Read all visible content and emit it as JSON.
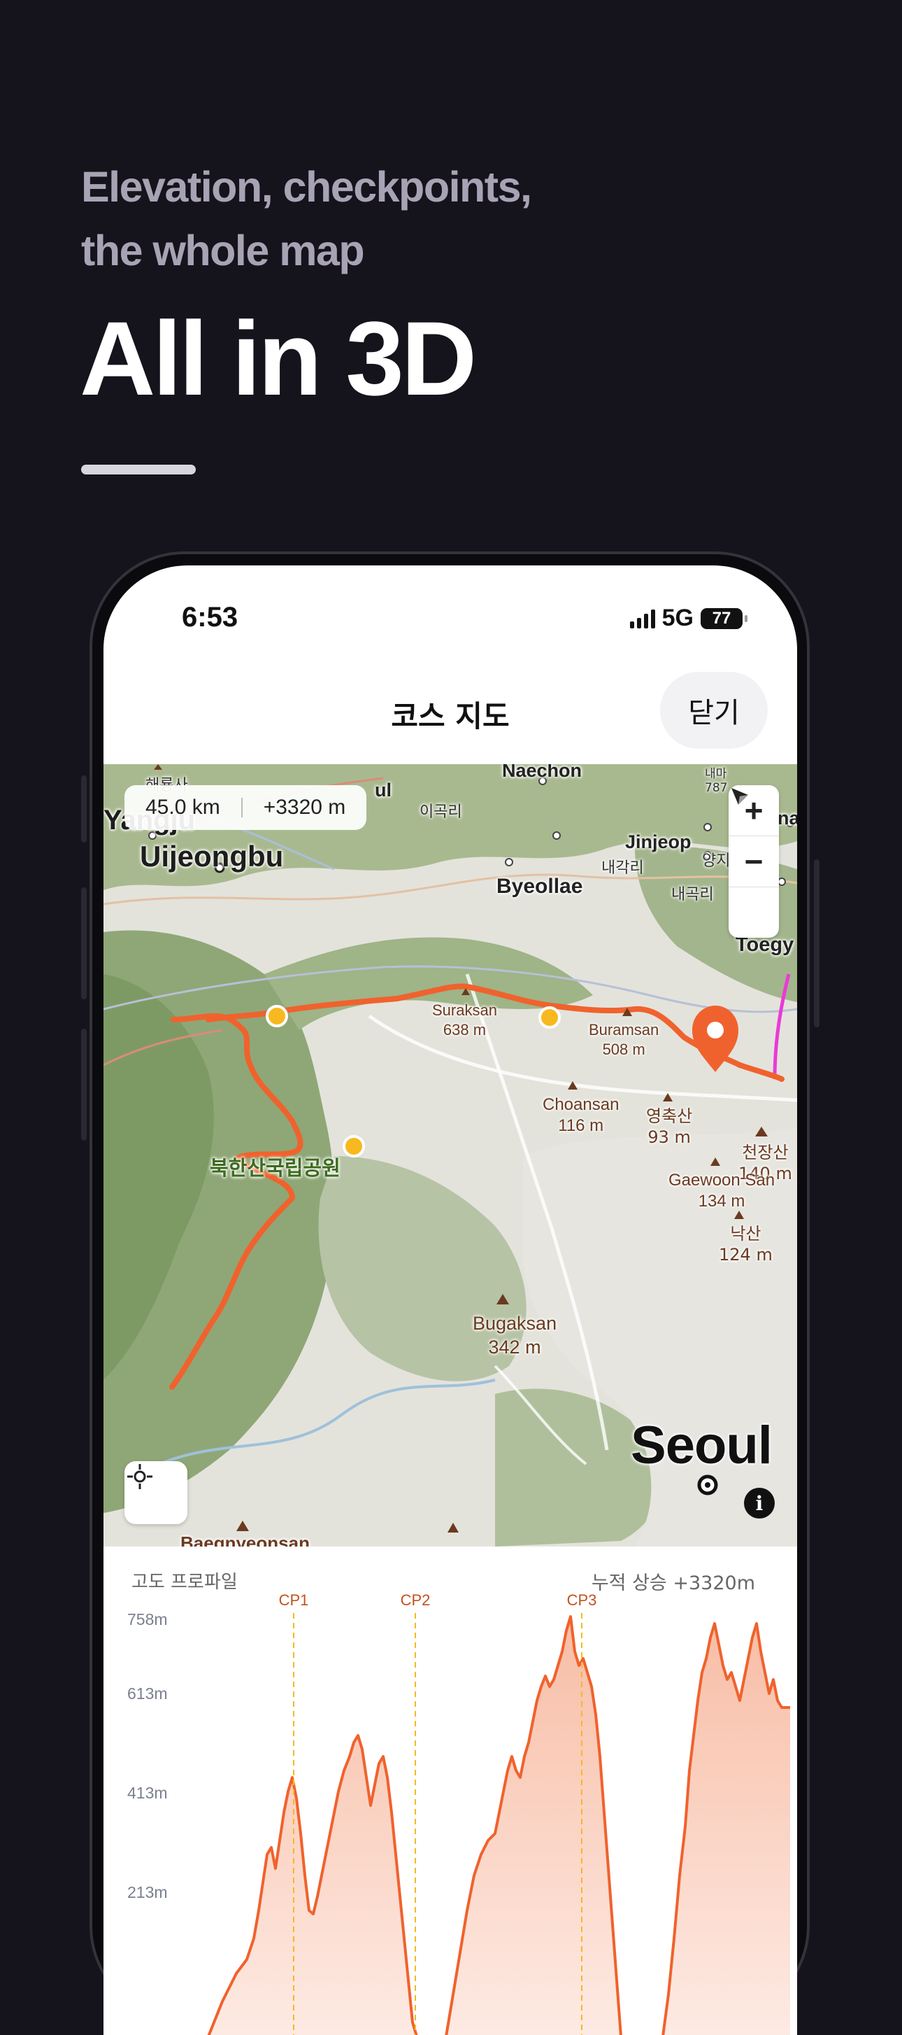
{
  "headline": {
    "subtitle_line1": "Elevation, checkpoints,",
    "subtitle_line2": "the whole map",
    "title": "All in 3D"
  },
  "status_bar": {
    "time": "6:53",
    "network": "5G",
    "battery": "77"
  },
  "nav": {
    "title": "코스 지도",
    "close_label": "닫기"
  },
  "map": {
    "distance": "45.0 km",
    "ascent": "+3320 m",
    "zoom_in_icon": "plus-icon",
    "zoom_out_icon": "minus-icon",
    "compass_icon": "navigation-arrow-icon",
    "locate_icon": "crosshair-icon",
    "info_icon": "info-icon",
    "route_color": "#f0622d",
    "checkpoint_color": "#f8b81f",
    "labels": {
      "naechon": "Naechon",
      "yangju": "Yangju",
      "uijeongbu": "Uijeongbu",
      "jinjeop": "Jinjeop",
      "byeollae": "Byeollae",
      "toegye": "Toegy",
      "igokri": "이곡리",
      "naegakri": "내각리",
      "naegokri": "내곡리",
      "yangji": "양지",
      "ul": "ul",
      "suraksan": "Suraksan",
      "suraksan_elev": "638 m",
      "buramsan": "Buramsan",
      "buramsan_elev": "508 m",
      "choansan": "Choansan",
      "choansan_elev": "116 m",
      "yeongchuksan": "영축산",
      "yeongchuksan_elev": "93 m",
      "cheonjangsan": "천장산",
      "cheonjangsan_elev": "140 m",
      "gaewoonsan": "Gaewoon San",
      "gaewoonsan_elev": "134 m",
      "naksan": "낙산",
      "naksan_elev": "124 m",
      "bugaksan": "Bugaksan",
      "bugaksan_elev": "342 m",
      "bukhansan_park": "북한산국립공원",
      "seoul": "Seoul",
      "baegnyeonsan": "Baegnyeonsan",
      "haeryongsa": "해룡사",
      "naema": "내마",
      "naema_elev": "787",
      "na": "na"
    }
  },
  "elevation": {
    "title": "고도 프로파일",
    "gain": "누적 상승 +3320m",
    "y_ticks": [
      "758m",
      "613m",
      "413m",
      "213m"
    ],
    "checkpoints": [
      "CP1",
      "CP2",
      "CP3"
    ],
    "line_color": "#f0622d"
  }
}
